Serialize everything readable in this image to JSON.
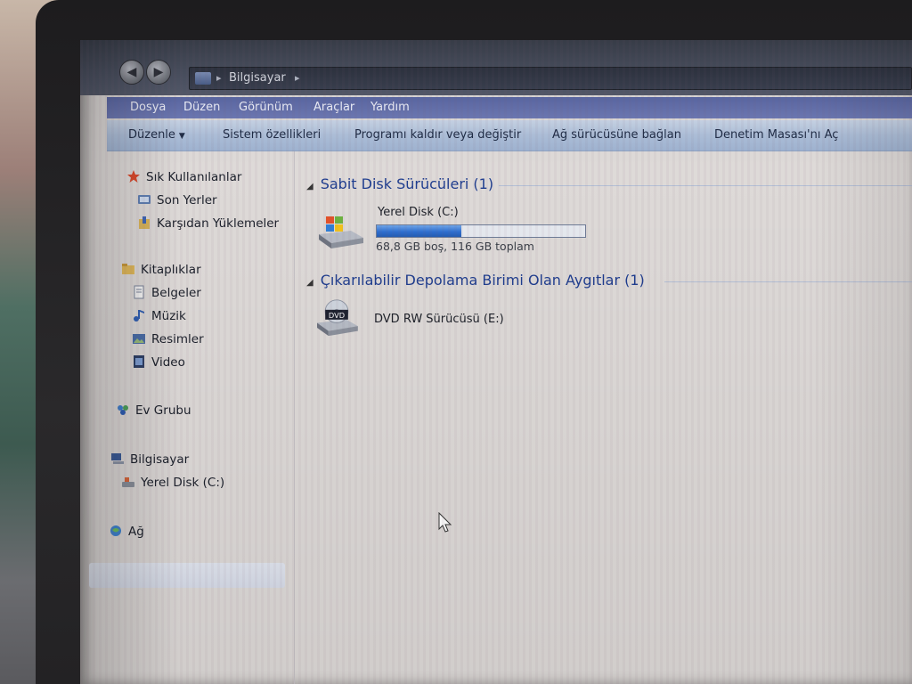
{
  "window": {
    "address_path": "Bilgisayar"
  },
  "menubar": {
    "items": [
      "Dosya",
      "Düzen",
      "Görünüm",
      "Araçlar",
      "Yardım"
    ]
  },
  "commandbar": {
    "organize": "Düzenle",
    "system_properties": "Sistem özellikleri",
    "uninstall": "Programı kaldır veya değiştir",
    "map_drive": "Ağ sürücüsüne bağlan",
    "control_panel": "Denetim Masası'nı Aç"
  },
  "navigation": {
    "favorites": {
      "label": "Sık Kullanılanlar",
      "items": [
        "Son Yerler",
        "Karşıdan Yüklemeler"
      ]
    },
    "libraries": {
      "label": "Kitaplıklar",
      "items": [
        "Belgeler",
        "Müzik",
        "Resimler",
        "Video"
      ]
    },
    "homegroup": "Ev Grubu",
    "computer": {
      "label": "Bilgisayar",
      "items": [
        "Yerel Disk (C:)"
      ]
    },
    "network": "Ağ"
  },
  "content": {
    "hard_disks": {
      "header": "Sabit Disk Sürücüleri (1)",
      "drives": [
        {
          "name": "Yerel Disk (C:)",
          "info": "68,8 GB boş, 116 GB toplam",
          "used_fraction": 0.407
        }
      ]
    },
    "removable": {
      "header": "Çıkarılabilir Depolama Birimi Olan Aygıtlar (1)",
      "drives": [
        {
          "name": "DVD RW Sürücüsü (E:)",
          "badge": "DVD"
        }
      ]
    }
  },
  "icons": {
    "back": "back-arrow-icon",
    "forward": "forward-arrow-icon",
    "favorites": "star-icon",
    "recent": "recent-places-icon",
    "downloads": "downloads-icon",
    "libraries": "libraries-icon",
    "documents": "document-icon",
    "music": "music-note-icon",
    "pictures": "pictures-icon",
    "video": "video-icon",
    "homegroup": "homegroup-icon",
    "computer": "computer-icon",
    "local_disk": "local-disk-icon",
    "network": "network-icon",
    "hard_drive": "hard-drive-icon",
    "dvd": "dvd-drive-icon",
    "cursor": "mouse-cursor-icon"
  },
  "colors": {
    "group_header": "#1e3d8f",
    "menubar": "#5b68a4",
    "commandbar": "#adbfd9",
    "capacity_bar": "#2e6fd0"
  }
}
